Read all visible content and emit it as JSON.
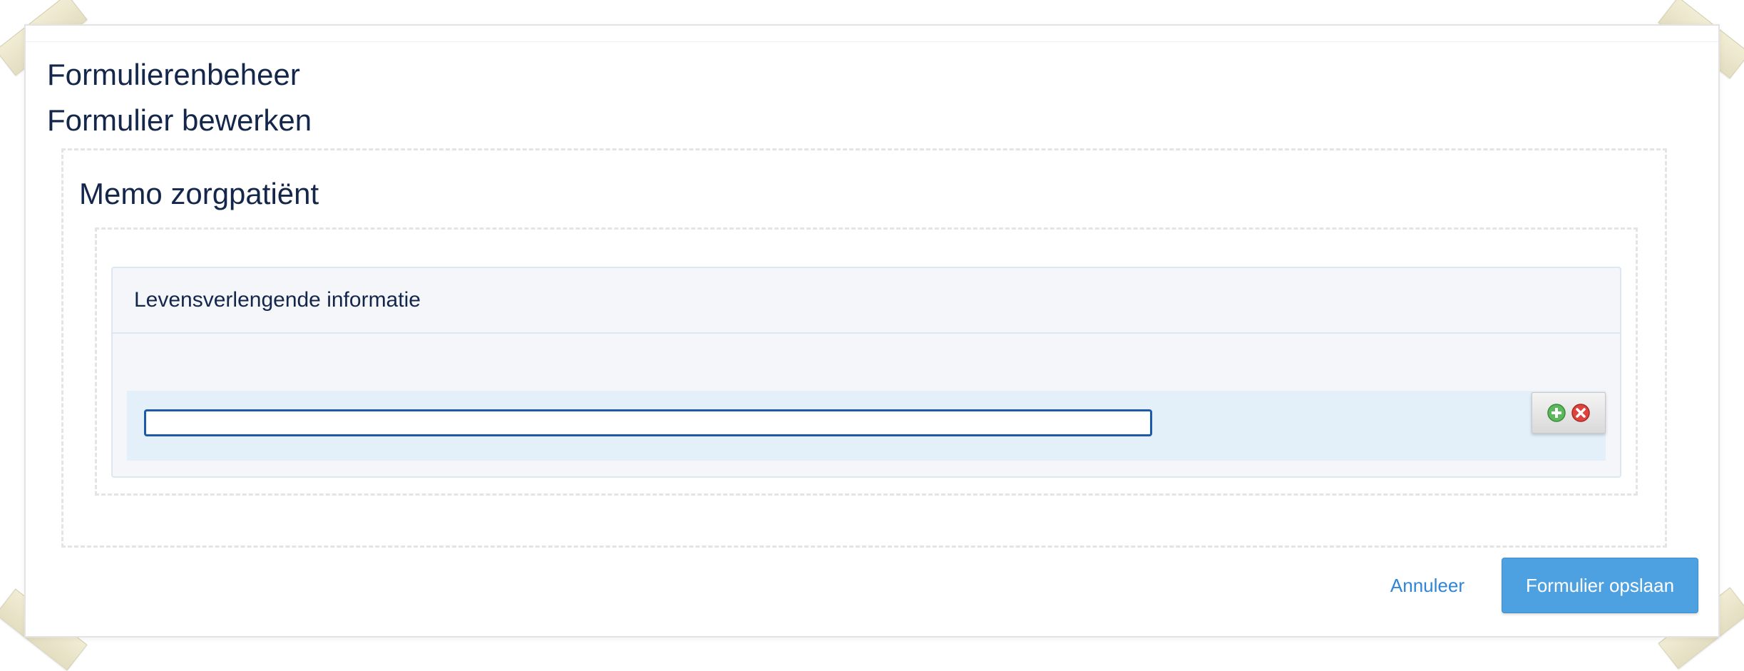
{
  "page": {
    "title_primary": "Formulierenbeheer",
    "title_secondary": "Formulier bewerken"
  },
  "form": {
    "section_title": "Memo zorgpatiënt",
    "panel_title": "Levensverlengende informatie",
    "input": {
      "value": "",
      "placeholder": ""
    },
    "row_actions": {
      "add_icon": "plus-circle-icon",
      "remove_icon": "x-circle-icon"
    }
  },
  "footer": {
    "cancel_label": "Annuleer",
    "save_label": "Formulier opslaan"
  },
  "colors": {
    "title_text": "#14264a",
    "link": "#2f86d6",
    "primary_button": "#4ea1e1",
    "row_background": "#e3f0f9",
    "input_focus_border": "#1d5aa8",
    "add_icon": "#5cb85c",
    "remove_icon": "#e0433d"
  }
}
